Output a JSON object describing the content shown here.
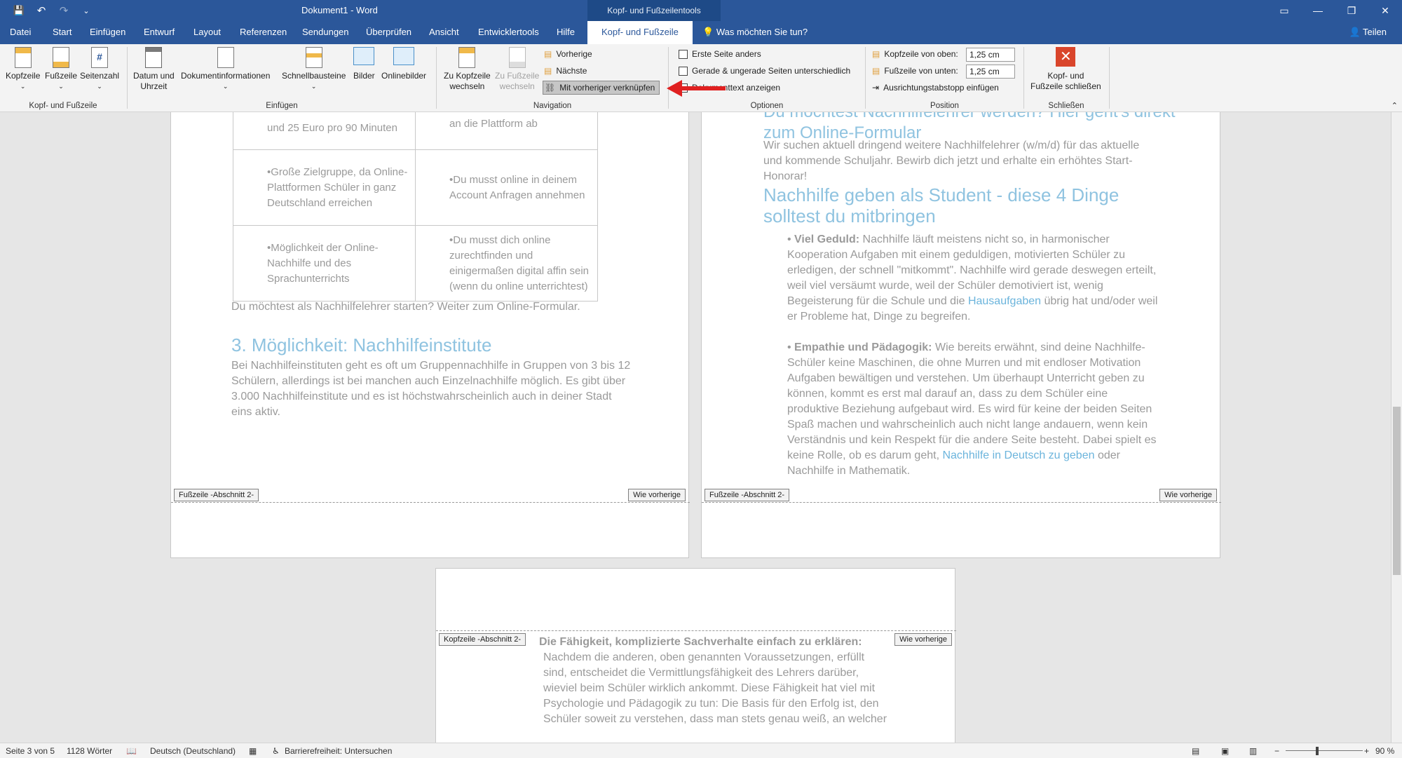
{
  "titlebar": {
    "doc_title": "Dokument1  -  Word",
    "context_tab": "Kopf- und Fußzeilentools",
    "minimize": "—",
    "restore": "❐",
    "close": "✕",
    "qat": {
      "save": "💾",
      "undo": "↶",
      "redo": "↷",
      "more": "⌄"
    }
  },
  "tabs": {
    "datei": "Datei",
    "start": "Start",
    "einfuegen": "Einfügen",
    "entwurf": "Entwurf",
    "layout": "Layout",
    "referenzen": "Referenzen",
    "sendungen": "Sendungen",
    "ueberpruefen": "Überprüfen",
    "ansicht": "Ansicht",
    "entwicklertools": "Entwicklertools",
    "hilfe": "Hilfe",
    "kopf_fusszeile": "Kopf- und Fußzeile",
    "tellme": "Was möchten Sie tun?",
    "share": "Teilen"
  },
  "ribbon": {
    "groups": {
      "kopf_fuss": "Kopf- und Fußzeile",
      "einfuegen": "Einfügen",
      "navigation": "Navigation",
      "optionen": "Optionen",
      "position": "Position",
      "schliessen": "Schließen"
    },
    "buttons": {
      "kopfzeile": "Kopfzeile",
      "fusszeile": "Fußzeile",
      "seitenzahl": "Seitenzahl",
      "datum_1": "Datum und",
      "datum_2": "Uhrzeit",
      "dokinfo": "Dokumentinformationen",
      "schnellbausteine": "Schnellbausteine",
      "bilder": "Bilder",
      "onlinebilder": "Onlinebilder",
      "zu_kopf_1": "Zu Kopfzeile",
      "zu_kopf_2": "wechseln",
      "zu_fuss_1": "Zu Fußzeile",
      "zu_fuss_2": "wechseln",
      "vorherige": "Vorherige",
      "naechste": "Nächste",
      "verknuepfen": "Mit vorheriger verknüpfen",
      "erste_seite": "Erste Seite anders",
      "gerade_ungerade": "Gerade & ungerade Seiten unterschiedlich",
      "dokumenttext": "Dokumenttext anzeigen",
      "kopf_oben": "Kopfzeile von oben:",
      "kopf_oben_val": "1,25 cm",
      "fuss_unten": "Fußzeile von unten:",
      "fuss_unten_val": "1,25 cm",
      "ausrichtung": "Ausrichtungstabstopp einfügen",
      "schliessen_1": "Kopf- und",
      "schliessen_2": "Fußzeile schließen"
    }
  },
  "page1": {
    "table": [
      [
        "und 25 Euro pro 90 Minuten",
        "an die Plattform ab"
      ],
      [
        "•Große Zielgruppe, da Online-Plattformen Schüler in ganz Deutschland erreichen",
        "•Du musst online in deinem Account Anfragen annehmen"
      ],
      [
        "•Möglichkeit der Online-Nachhilfe und des Sprachunterrichts",
        "•Du musst dich online zurechtfinden und einigermaßen digital affin sein (wenn du online unterrichtest)"
      ]
    ],
    "after_table": "Du möchtest als Nachhilfelehrer starten? Weiter zum Online-Formular.",
    "heading": "3. Möglichkeit: Nachhilfeinstitute",
    "para": "Bei Nachhilfeinstituten geht es oft um Gruppennachhilfe in Gruppen von 3 bis 12 Schülern, allerdings ist bei manchen auch Einzelnachhilfe möglich. Es gibt über 3.000 Nachhilfeinstitute und es ist höchstwahrscheinlich auch in deiner Stadt eins aktiv.",
    "footer_tag": "Fußzeile -Abschnitt 2-",
    "same_as": "Wie vorherige"
  },
  "page2": {
    "top_head_1": "Du möchtest Nachhilfelehrer werden? Hier geht's direkt",
    "top_head_2": "zum Online-Formular",
    "para1": "Wir suchen aktuell dringend weitere Nachhilfelehrer (w/m/d) für das aktuelle und kommende Schuljahr. Bewirb dich jetzt und erhalte ein erhöhtes Start-Honorar!",
    "heading": "Nachhilfe geben als Student - diese 4 Dinge solltest du mitbringen",
    "b1_bold": "Viel Geduld:",
    "b1_text": " Nachhilfe läuft meistens nicht so, in harmonischer Kooperation Aufgaben mit einem geduldigen, motivierten Schüler zu erledigen, der schnell \"mitkommt\". Nachhilfe wird gerade deswegen erteilt, weil viel versäumt wurde, weil der Schüler demotiviert ist, wenig Begeisterung für die Schule und die ",
    "b1_link": "Hausaufgaben",
    "b1_tail": " übrig hat und/oder weil er Probleme hat, Dinge zu begreifen.",
    "b2_bold": "Empathie und Pädagogik:",
    "b2_text": " Wie bereits erwähnt, sind deine Nachhilfe-Schüler keine Maschinen, die ohne Murren und mit endloser Motivation Aufgaben bewältigen und verstehen. Um überhaupt Unterricht geben zu können, kommt es erst mal darauf an, dass zu dem Schüler eine produktive Beziehung aufgebaut wird. Es wird für keine der beiden Seiten Spaß machen und wahrscheinlich auch nicht lange andauern, wenn kein Verständnis und kein Respekt für die andere Seite besteht. Dabei spielt es keine Rolle, ob es darum geht, ",
    "b2_link": "Nachhilfe in Deutsch zu geben",
    "b2_tail": " oder Nachhilfe in Mathematik.",
    "footer_tag": "Fußzeile -Abschnitt 2-",
    "same_as": "Wie vorherige"
  },
  "page3": {
    "header_tag": "Kopfzeile -Abschnitt 2-",
    "same_as": "Wie vorherige",
    "b3_bold": "Die Fähigkeit, komplizierte Sachverhalte einfach zu erklären:",
    "b3_text": " Nachdem die anderen, oben genannten Voraussetzungen, erfüllt sind, entscheidet die Vermittlungsfähigkeit des Lehrers darüber, wieviel beim Schüler wirklich ankommt. Diese Fähigkeit hat viel mit Psychologie und Pädagogik zu tun: Die Basis für den Erfolg ist, den Schüler soweit zu verstehen, dass man stets genau weiß, an welcher"
  },
  "status": {
    "page": "Seite 3 von 5",
    "words": "1128 Wörter",
    "language": "Deutsch (Deutschland)",
    "accessibility": "Barrierefreiheit: Untersuchen",
    "zoom": "90 %"
  }
}
